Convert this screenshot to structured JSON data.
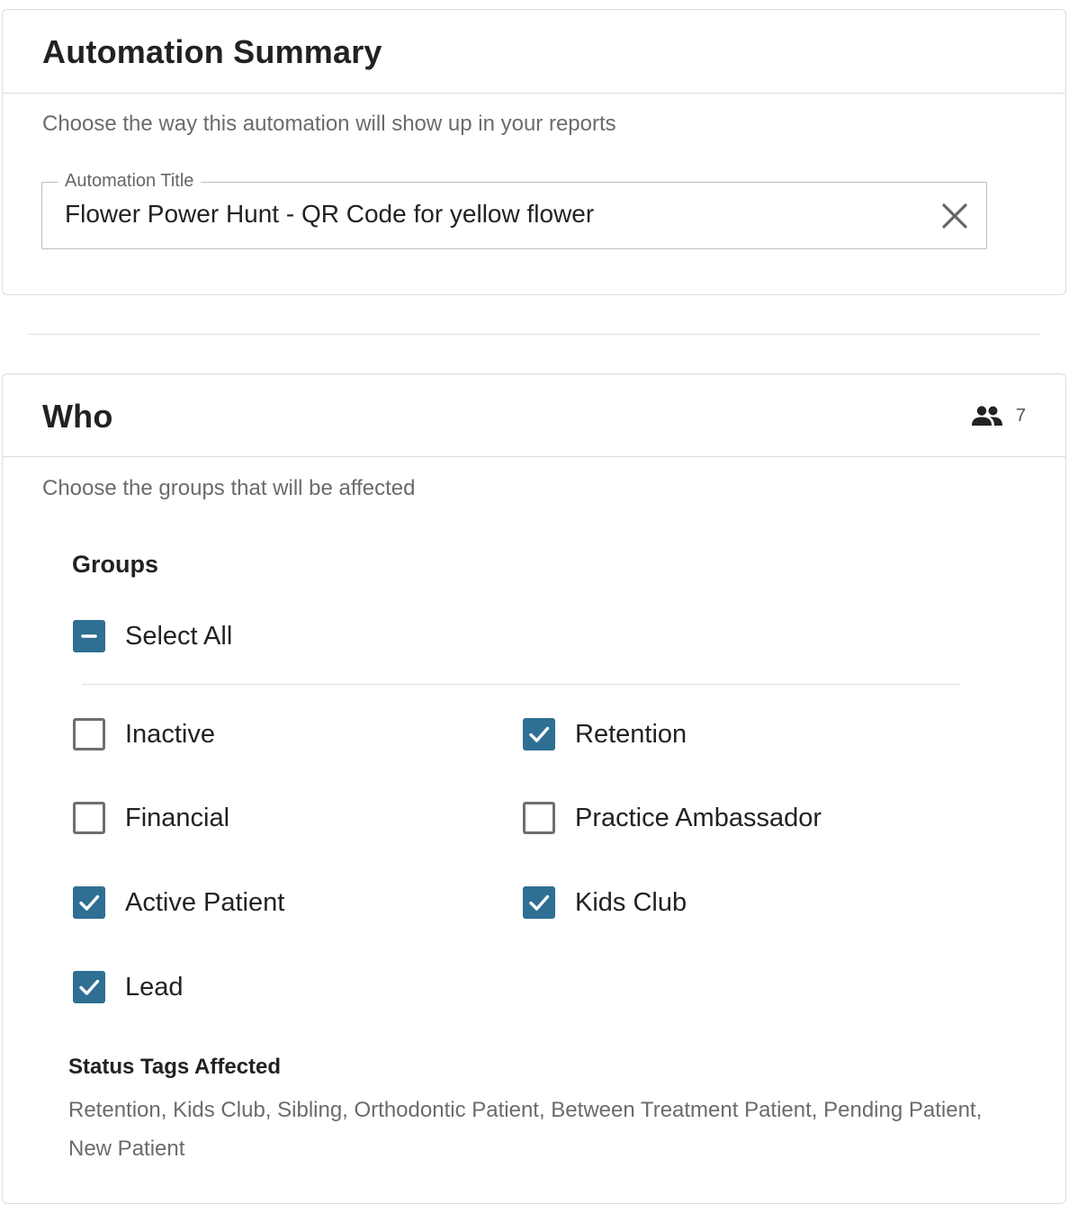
{
  "summary": {
    "title": "Automation Summary",
    "subtitle": "Choose the way this automation will show up in your reports",
    "field_label": "Automation Title",
    "field_value": "Flower Power Hunt - QR Code for yellow flower"
  },
  "who": {
    "title": "Who",
    "subtitle": "Choose the groups that will be affected",
    "count": "7",
    "groups_title": "Groups",
    "select_all": {
      "label": "Select All",
      "state": "indeterminate"
    },
    "groups": [
      {
        "label": "Inactive",
        "checked": false
      },
      {
        "label": "Retention",
        "checked": true
      },
      {
        "label": "Financial",
        "checked": false
      },
      {
        "label": "Practice Ambassador",
        "checked": false
      },
      {
        "label": "Active Patient",
        "checked": true
      },
      {
        "label": "Kids Club",
        "checked": true
      },
      {
        "label": "Lead",
        "checked": true
      }
    ],
    "status_title": "Status Tags Affected",
    "status_text": "Retention, Kids Club, Sibling, Orthodontic Patient, Between Treatment Patient, Pending Patient, New Patient"
  },
  "colors": {
    "accent": "#2e6f93",
    "muted_text": "#6b6b6b",
    "border": "#dcdcdc"
  },
  "icons": {
    "clear": "close-icon",
    "count": "people-icon",
    "checked": "check-icon",
    "indeterminate": "minus-icon"
  }
}
